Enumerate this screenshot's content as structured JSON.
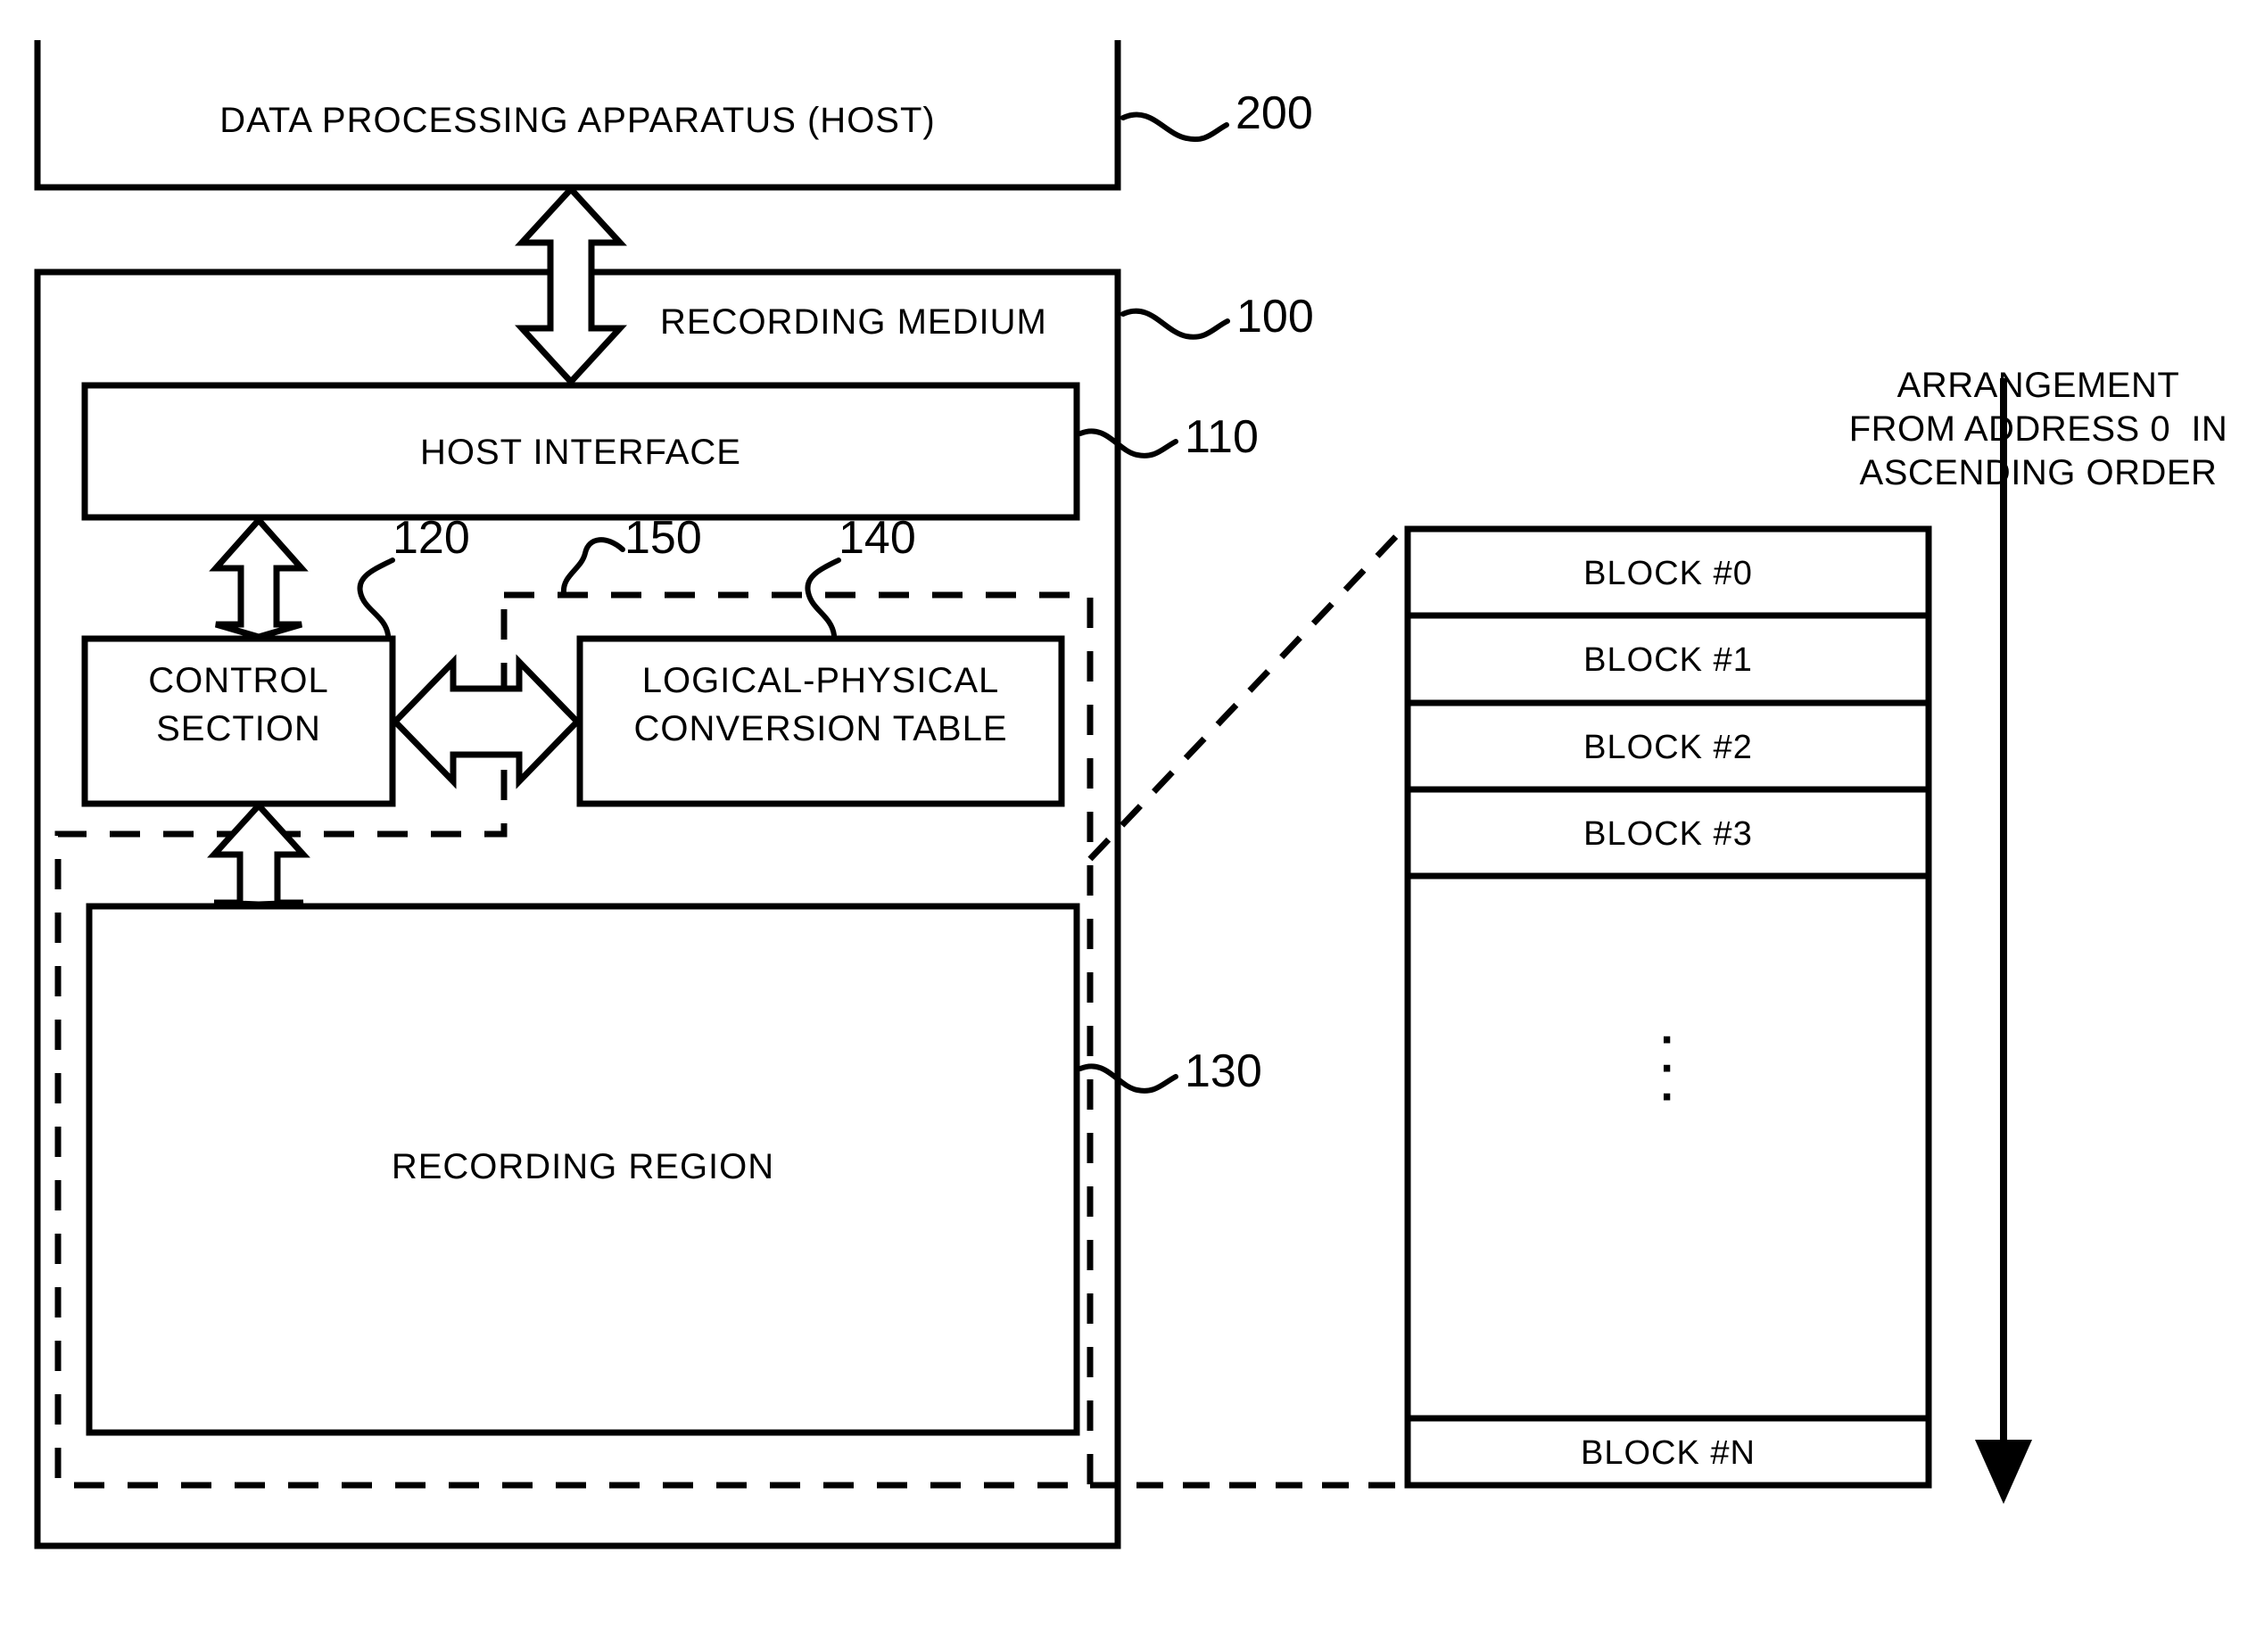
{
  "figure": {
    "type": "patent-block-diagram",
    "background_color": "#ffffff",
    "line_color": "#000000"
  },
  "host_box": {
    "label": "DATA PROCESSING APPARATUS (HOST)",
    "ref": "200"
  },
  "recording_medium": {
    "label": "RECORDING MEDIUM",
    "ref": "100"
  },
  "host_interface": {
    "label": "HOST INTERFACE",
    "ref": "110"
  },
  "control_section": {
    "line1": "CONTROL",
    "line2": "SECTION",
    "ref": "120"
  },
  "conversion_table": {
    "line1": "LOGICAL-PHYSICAL",
    "line2": "CONVERSION TABLE",
    "ref": "140"
  },
  "dashed_boundary": {
    "ref": "150"
  },
  "recording_region": {
    "label": "RECORDING REGION",
    "ref": "130"
  },
  "block_table": {
    "rows": [
      "BLOCK #0",
      "BLOCK #1",
      "BLOCK #2",
      "BLOCK #3"
    ],
    "ellipsis": "·\n·\n·",
    "last_row": "BLOCK #N"
  },
  "arrangement_note": {
    "line1": "ARRANGEMENT",
    "line2": "FROM ADDRESS 0  IN",
    "line3": "ASCENDING ORDER"
  }
}
